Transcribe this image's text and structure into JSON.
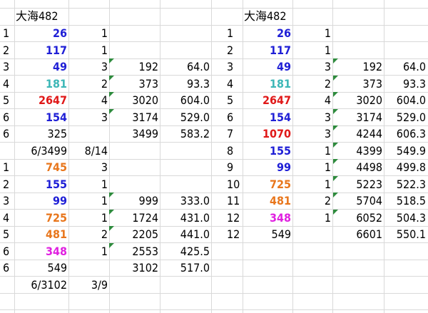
{
  "colors": {
    "blue": "#1f1fd6",
    "cyan": "#3db7b7",
    "red": "#e01818",
    "orange": "#e8761c",
    "magenta": "#e020e0",
    "black": "#000000",
    "gridline": "#d9d9d9",
    "comment_marker": "#2e8b3d"
  },
  "left": {
    "title": "大海482",
    "rows": [
      {
        "a": "1",
        "b": "26",
        "b_color": "blue",
        "b_bold": true,
        "c": "1",
        "d": "",
        "e": ""
      },
      {
        "a": "2",
        "b": "117",
        "b_color": "blue",
        "b_bold": true,
        "c": "1",
        "d": "",
        "e": ""
      },
      {
        "a": "3",
        "b": "49",
        "b_color": "blue",
        "b_bold": true,
        "c": "3",
        "d": "192",
        "e": "64.0"
      },
      {
        "a": "4",
        "b": "181",
        "b_color": "cyan",
        "b_bold": true,
        "c": "2",
        "d": "373",
        "e": "93.3"
      },
      {
        "a": "5",
        "b": "2647",
        "b_color": "red",
        "b_bold": true,
        "c": "4",
        "d": "3020",
        "e": "604.0"
      },
      {
        "a": "6",
        "b": "154",
        "b_color": "blue",
        "b_bold": true,
        "c": "3",
        "d": "3174",
        "e": "529.0"
      },
      {
        "a": "6",
        "b": "325",
        "b_color": "black",
        "b_bold": false,
        "c": "",
        "d": "3499",
        "e": "583.2"
      },
      {
        "a": "",
        "b": "6/3499",
        "b_color": "black",
        "b_bold": false,
        "c": "8/14",
        "d": "",
        "e": ""
      },
      {
        "a": "1",
        "b": "745",
        "b_color": "orange",
        "b_bold": true,
        "c": "3",
        "d": "",
        "e": ""
      },
      {
        "a": "2",
        "b": "155",
        "b_color": "blue",
        "b_bold": true,
        "c": "1",
        "d": "",
        "e": ""
      },
      {
        "a": "3",
        "b": "99",
        "b_color": "blue",
        "b_bold": true,
        "c": "1",
        "d": "999",
        "e": "333.0"
      },
      {
        "a": "4",
        "b": "725",
        "b_color": "orange",
        "b_bold": true,
        "c": "1",
        "d": "1724",
        "e": "431.0"
      },
      {
        "a": "5",
        "b": "481",
        "b_color": "orange",
        "b_bold": true,
        "c": "2",
        "d": "2205",
        "e": "441.0"
      },
      {
        "a": "6",
        "b": "348",
        "b_color": "magenta",
        "b_bold": true,
        "c": "1",
        "d": "2553",
        "e": "425.5"
      },
      {
        "a": "6",
        "b": "549",
        "b_color": "black",
        "b_bold": false,
        "c": "",
        "d": "3102",
        "e": "517.0"
      },
      {
        "a": "",
        "b": "6/3102",
        "b_color": "black",
        "b_bold": false,
        "c": "3/9",
        "d": "",
        "e": ""
      }
    ]
  },
  "right": {
    "title": "大海482",
    "rows": [
      {
        "a": "1",
        "b": "26",
        "b_color": "blue",
        "b_bold": true,
        "c": "1",
        "d": "",
        "e": ""
      },
      {
        "a": "2",
        "b": "117",
        "b_color": "blue",
        "b_bold": true,
        "c": "1",
        "d": "",
        "e": ""
      },
      {
        "a": "3",
        "b": "49",
        "b_color": "blue",
        "b_bold": true,
        "c": "3",
        "d": "192",
        "e": "64.0"
      },
      {
        "a": "4",
        "b": "181",
        "b_color": "cyan",
        "b_bold": true,
        "c": "2",
        "d": "373",
        "e": "93.3"
      },
      {
        "a": "5",
        "b": "2647",
        "b_color": "red",
        "b_bold": true,
        "c": "4",
        "d": "3020",
        "e": "604.0"
      },
      {
        "a": "6",
        "b": "154",
        "b_color": "blue",
        "b_bold": true,
        "c": "3",
        "d": "3174",
        "e": "529.0"
      },
      {
        "a": "7",
        "b": "1070",
        "b_color": "red",
        "b_bold": true,
        "c": "3",
        "d": "4244",
        "e": "606.3"
      },
      {
        "a": "8",
        "b": "155",
        "b_color": "blue",
        "b_bold": true,
        "c": "1",
        "d": "4399",
        "e": "549.9"
      },
      {
        "a": "9",
        "b": "99",
        "b_color": "blue",
        "b_bold": true,
        "c": "1",
        "d": "4498",
        "e": "499.8"
      },
      {
        "a": "10",
        "b": "725",
        "b_color": "orange",
        "b_bold": true,
        "c": "1",
        "d": "5223",
        "e": "522.3"
      },
      {
        "a": "11",
        "b": "481",
        "b_color": "orange",
        "b_bold": true,
        "c": "2",
        "d": "5704",
        "e": "518.5"
      },
      {
        "a": "12",
        "b": "348",
        "b_color": "magenta",
        "b_bold": true,
        "c": "1",
        "d": "6052",
        "e": "504.3"
      },
      {
        "a": "12",
        "b": "549",
        "b_color": "black",
        "b_bold": false,
        "c": "",
        "d": "6601",
        "e": "550.1"
      }
    ]
  }
}
